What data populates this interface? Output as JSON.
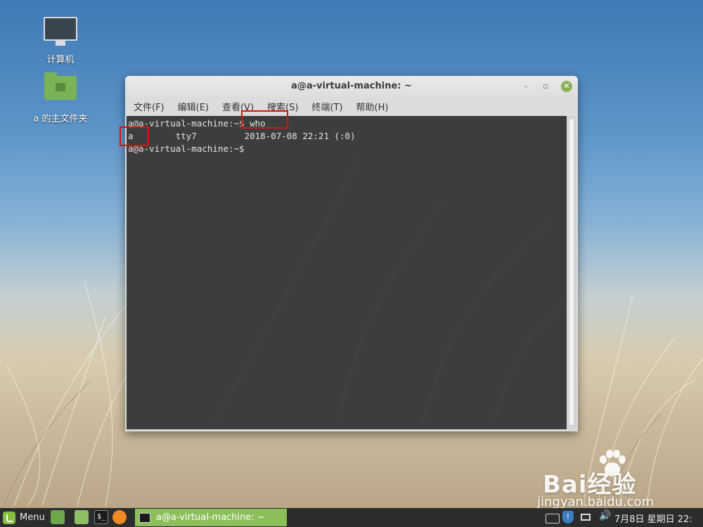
{
  "desktop": {
    "icons": [
      {
        "label": "计算机",
        "icon": "computer-icon"
      },
      {
        "label": "a 的主文件夹",
        "icon": "home-folder-icon"
      }
    ]
  },
  "window": {
    "title": "a@a-virtual-machine: ~",
    "controls": {
      "minimize": "-",
      "maximize": "▫",
      "close": "✕"
    },
    "menu": [
      "文件(F)",
      "编辑(E)",
      "查看(V)",
      "搜索(S)",
      "终端(T)",
      "帮助(H)"
    ]
  },
  "terminal": {
    "lines": [
      "a@a-virtual-machine:~$ who",
      "a        tty7         2018-07-08 22:21 (:0)",
      "a@a-virtual-machine:~$"
    ],
    "highlighted": [
      "who",
      "a"
    ]
  },
  "taskbar": {
    "menu_label": "Menu",
    "terminal_launcher_glyph": "$_",
    "active_task": "a@a-virtual-machine: ~",
    "clock": "7月8日 星期日 22:",
    "tray_icons": [
      "keyboard-icon",
      "shield-update-icon",
      "network-icon",
      "volume-icon"
    ]
  },
  "watermark": {
    "brand": "Bai经验",
    "url": "jingyan.baidu.com"
  },
  "colors": {
    "terminal_bg": "#3c3e3e",
    "accent_green": "#8bbf5a",
    "highlight_red": "#e01010"
  }
}
